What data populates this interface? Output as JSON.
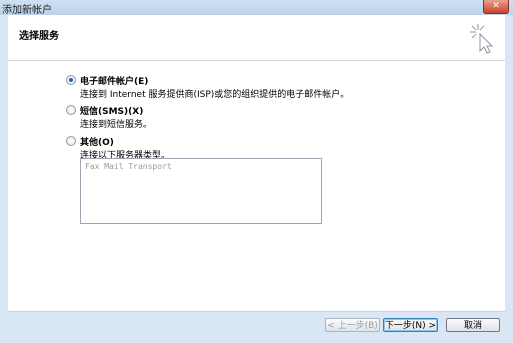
{
  "window": {
    "title": "添加新帐户",
    "close_label": "✕"
  },
  "header": {
    "title": "选择服务",
    "icon": "wizard-sparkle-cursor-icon"
  },
  "options": [
    {
      "label": "电子邮件帐户(E)",
      "description": "连接到 Internet 服务提供商(ISP)或您的组织提供的电子邮件帐户。",
      "checked": true
    },
    {
      "label": "短信(SMS)(X)",
      "description": "连接到短信服务。",
      "checked": false
    },
    {
      "label": "其他(O)",
      "description": "连接以下服务器类型。",
      "checked": false
    }
  ],
  "server_types": {
    "items": [
      "Fax Mail Transport"
    ]
  },
  "buttons": {
    "back": "< 上一步(B)",
    "next": "下一步(N) >",
    "cancel": "取消"
  }
}
